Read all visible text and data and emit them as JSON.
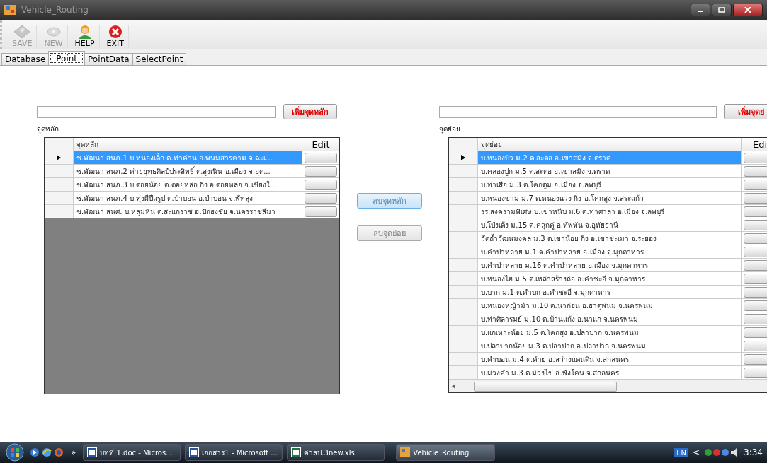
{
  "window": {
    "title": "Vehicle_Routing"
  },
  "toolbar": [
    {
      "label": "SAVE",
      "kind": "save",
      "disabled": true
    },
    {
      "label": "NEW",
      "kind": "new",
      "disabled": true
    },
    {
      "label": "HELP",
      "kind": "help",
      "disabled": false
    },
    {
      "label": "EXIT",
      "kind": "exit",
      "disabled": false
    }
  ],
  "tabs": [
    {
      "label": "Database",
      "selected": false
    },
    {
      "label": "Point",
      "selected": true
    },
    {
      "label": "PointData",
      "selected": false
    },
    {
      "label": "SelectPoint",
      "selected": false
    }
  ],
  "main_points": {
    "add_button": "เพิ่มจุดหลัก",
    "label": "จุดหลัก",
    "columns": [
      "จุดหลัก",
      "Edit"
    ],
    "rows": [
      {
        "text": "ช.พัฒนา สนภ.1 บ.หนองเด็ก ต.ท่าค่าน อ.พนมสารคาม จ.ฉะเ...",
        "selected": true
      },
      {
        "text": "ช.พัฒนา สนภ.2 ค่ายยุทธศิลป์ประสิทธิ์ ต.สูงเนิน อ.เมือง จ.อุด...",
        "selected": false
      },
      {
        "text": "ช.พัฒนา สนภ.3 บ.ดอยน้อย ต.ดอยหล่อ กิ่ง อ.ดอยหล่อ จ.เชียงใ...",
        "selected": false
      },
      {
        "text": "ช.พัฒนา สนภ.4  บ.ทุ่งผีปีแรูป  ต.ป่าบอน  อ.ป่าบอน จ.พัทลุง",
        "selected": false
      },
      {
        "text": "ช.พัฒนา สนศ. บ.หลุมหิน ต.สะแกราช อ.ปักธงชัย จ.นครราชสีมา",
        "selected": false
      }
    ]
  },
  "middle_buttons": [
    {
      "label": "ลบจุดหลัก",
      "disabled": true,
      "focused": true
    },
    {
      "label": "ลบจุดย่อย",
      "disabled": true,
      "focused": false
    }
  ],
  "sub_points": {
    "add_button": "เพิ่มจุดย่",
    "label": "จุดย่อย",
    "columns": [
      "จุดย่อย",
      "Edi"
    ],
    "rows": [
      {
        "text": "บ.หนองบัว ม.2 ต.สะตอ อ.เขาสมิง จ.ตราด",
        "selected": true
      },
      {
        "text": "บ.คลองปูก ม.5 ต.สะตอ อ.เขาสมิง จ.ตราด",
        "selected": false
      },
      {
        "text": "บ.ท่าเสือ ม.3 ต.โคกตูม อ.เมือง จ.ลพบุรี",
        "selected": false
      },
      {
        "text": "บ.หนองขาม ม.7 ต.หนองแวง กิ่ง อ.โคกสูง จ.สระแก้ว",
        "selected": false
      },
      {
        "text": "รร.สงครามพิเศษ บ.เขาหนีบ ม.6 ต.ท่าศาลา อ.เมือง จ.ลพบุรี",
        "selected": false
      },
      {
        "text": "บ.โป่งเต้ง ม.15 ต.คลุกคู่ อ.ทัพทัน จ.อุทัยธานี",
        "selected": false
      },
      {
        "text": "วัดถ้ำวัฒนมงคล ม.3 ต.เขาน้อย กิ่ง อ.เขาชะเมา จ.ระยอง",
        "selected": false
      },
      {
        "text": "บ.คำป่าหลาย ม.1 ต.คำป่าหลาย อ.เมือง จ.มุกดาหาร",
        "selected": false
      },
      {
        "text": "บ.คำป่าหลาย ม.16 ต.คำป่าหลาย อ.เมือง จ.มุกดาหาร",
        "selected": false
      },
      {
        "text": "บ.หนองไฮ ม.5 ต.เหล่าสร้างถ่อ อ.คำชะอี จ.มุกดาหาร",
        "selected": false
      },
      {
        "text": "บ.บาก ม.1 ต.คำบก อ.คำชะอี จ.มุกดาหาร",
        "selected": false
      },
      {
        "text": "บ.หนองหญ้าม้า ม.10 ต.นาก่อน อ.ธาตุพนม จ.นครพนม",
        "selected": false
      },
      {
        "text": "บ.ท่าศิลารมย์ ม.10 ต.บ้านแก้ง อ.นาแก จ.นครพนม",
        "selected": false
      },
      {
        "text": "บ.แกเหาะน้อย ม.5 ต.โคกสูง อ.ปลาปาก จ.นครพนม",
        "selected": false
      },
      {
        "text": "บ.ปลาปากน้อย ม.3 ต.ปลาปาก อ.ปลาปาก จ.นครพนม",
        "selected": false
      },
      {
        "text": "บ.คำบอน ม.4 ต.ค้าย อ.สว่างแดนดิน จ.สกลนคร",
        "selected": false
      },
      {
        "text": "บ.ม่วงคำ ม.3 ต.ม่วงไข่ อ.พังโคน จ.สกลนคร",
        "selected": false
      }
    ]
  },
  "taskbar": {
    "overflow": "»",
    "tasks": [
      {
        "label": "บทที่ 1.doc - Micros...",
        "kind": "word",
        "selected": false
      },
      {
        "label": "เอกสาร1 - Microsoft ...",
        "kind": "word",
        "selected": false
      },
      {
        "label": "ค่าสป.3new.xls",
        "kind": "excel",
        "selected": false
      },
      {
        "label": "Vehicle_Routing",
        "kind": "app",
        "selected": true
      }
    ],
    "language": "EN",
    "tray_toggle": "<",
    "clock": "3:34"
  }
}
